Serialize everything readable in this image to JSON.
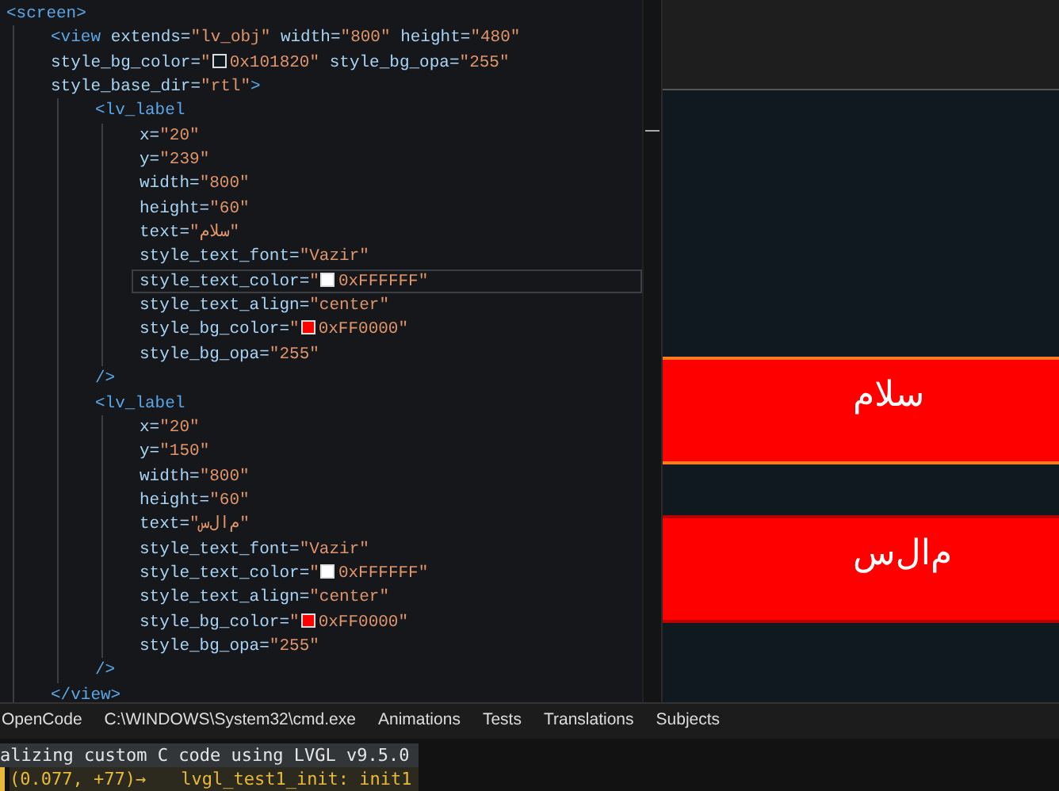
{
  "editor": {
    "lines": [
      {
        "current": false,
        "tokens": [
          {
            "kind": "tag",
            "text": "<screen>"
          }
        ],
        "children": [
          {
            "current": false,
            "tokens": [
              {
                "kind": "tag",
                "text": "<view"
              },
              {
                "kind": "attr",
                "text": " extends="
              },
              {
                "kind": "value",
                "text": "\"lv_obj\""
              },
              {
                "kind": "attr",
                "text": " width="
              },
              {
                "kind": "value",
                "text": "\"800\""
              },
              {
                "kind": "attr",
                "text": " height="
              },
              {
                "kind": "value",
                "text": "\"480\""
              }
            ]
          },
          {
            "current": false,
            "tokens": [
              {
                "kind": "attr",
                "text": "style_bg_color="
              },
              {
                "kind": "value",
                "text": "\""
              },
              {
                "kind": "swatch",
                "color": "#101820"
              },
              {
                "kind": "value",
                "text": "0x101820\""
              },
              {
                "kind": "attr",
                "text": " style_bg_opa="
              },
              {
                "kind": "value",
                "text": "\"255\""
              }
            ]
          },
          {
            "current": false,
            "tokens": [
              {
                "kind": "attr",
                "text": "style_base_dir="
              },
              {
                "kind": "value",
                "text": "\"rtl\""
              },
              {
                "kind": "tag",
                "text": ">"
              }
            ],
            "children": [
              {
                "current": false,
                "tokens": [
                  {
                    "kind": "tag",
                    "text": "<lv_label"
                  }
                ],
                "children": [
                  {
                    "current": false,
                    "tokens": [
                      {
                        "kind": "attr",
                        "text": "x="
                      },
                      {
                        "kind": "value",
                        "text": "\"20\""
                      }
                    ]
                  },
                  {
                    "current": false,
                    "tokens": [
                      {
                        "kind": "attr",
                        "text": "y="
                      },
                      {
                        "kind": "value",
                        "text": "\"239\""
                      }
                    ]
                  },
                  {
                    "current": false,
                    "tokens": [
                      {
                        "kind": "attr",
                        "text": "width="
                      },
                      {
                        "kind": "value",
                        "text": "\"800\""
                      }
                    ]
                  },
                  {
                    "current": false,
                    "tokens": [
                      {
                        "kind": "attr",
                        "text": "height="
                      },
                      {
                        "kind": "value",
                        "text": "\"60\""
                      }
                    ]
                  },
                  {
                    "current": false,
                    "tokens": [
                      {
                        "kind": "attr",
                        "text": "text="
                      },
                      {
                        "kind": "value",
                        "text": "\"سلام\""
                      }
                    ]
                  },
                  {
                    "current": false,
                    "tokens": [
                      {
                        "kind": "attr",
                        "text": "style_text_font="
                      },
                      {
                        "kind": "value",
                        "text": "\"Vazir\""
                      }
                    ]
                  },
                  {
                    "current": true,
                    "tokens": [
                      {
                        "kind": "attr",
                        "text": "style_text_color="
                      },
                      {
                        "kind": "value",
                        "text": "\""
                      },
                      {
                        "kind": "swatch",
                        "color": "#ffffff"
                      },
                      {
                        "kind": "value",
                        "text": "0xFFFFFF\""
                      }
                    ]
                  },
                  {
                    "current": false,
                    "tokens": [
                      {
                        "kind": "attr",
                        "text": "style_text_align="
                      },
                      {
                        "kind": "value",
                        "text": "\"center\""
                      }
                    ]
                  },
                  {
                    "current": false,
                    "tokens": [
                      {
                        "kind": "attr",
                        "text": "style_bg_color="
                      },
                      {
                        "kind": "value",
                        "text": "\""
                      },
                      {
                        "kind": "swatch",
                        "color": "#ff0000"
                      },
                      {
                        "kind": "value",
                        "text": "0xFF0000\""
                      }
                    ]
                  },
                  {
                    "current": false,
                    "tokens": [
                      {
                        "kind": "attr",
                        "text": "style_bg_opa="
                      },
                      {
                        "kind": "value",
                        "text": "\"255\""
                      }
                    ]
                  }
                ]
              },
              {
                "current": false,
                "tokens": [
                  {
                    "kind": "tag",
                    "text": "/>"
                  }
                ]
              },
              {
                "current": false,
                "tokens": [
                  {
                    "kind": "tag",
                    "text": "<lv_label"
                  }
                ],
                "children": [
                  {
                    "current": false,
                    "tokens": [
                      {
                        "kind": "attr",
                        "text": "x="
                      },
                      {
                        "kind": "value",
                        "text": "\"20\""
                      }
                    ]
                  },
                  {
                    "current": false,
                    "tokens": [
                      {
                        "kind": "attr",
                        "text": "y="
                      },
                      {
                        "kind": "value",
                        "text": "\"150\""
                      }
                    ]
                  },
                  {
                    "current": false,
                    "tokens": [
                      {
                        "kind": "attr",
                        "text": "width="
                      },
                      {
                        "kind": "value",
                        "text": "\"800\""
                      }
                    ]
                  },
                  {
                    "current": false,
                    "tokens": [
                      {
                        "kind": "attr",
                        "text": "height="
                      },
                      {
                        "kind": "value",
                        "text": "\"60\""
                      }
                    ]
                  },
                  {
                    "current": false,
                    "tokens": [
                      {
                        "kind": "attr",
                        "text": "text="
                      },
                      {
                        "kind": "value",
                        "text": "\"ﻡﺍﻝﺱ\""
                      }
                    ]
                  },
                  {
                    "current": false,
                    "tokens": [
                      {
                        "kind": "attr",
                        "text": "style_text_font="
                      },
                      {
                        "kind": "value",
                        "text": "\"Vazir\""
                      }
                    ]
                  },
                  {
                    "current": false,
                    "tokens": [
                      {
                        "kind": "attr",
                        "text": "style_text_color="
                      },
                      {
                        "kind": "value",
                        "text": "\""
                      },
                      {
                        "kind": "swatch",
                        "color": "#ffffff"
                      },
                      {
                        "kind": "value",
                        "text": "0xFFFFFF\""
                      }
                    ]
                  },
                  {
                    "current": false,
                    "tokens": [
                      {
                        "kind": "attr",
                        "text": "style_text_align="
                      },
                      {
                        "kind": "value",
                        "text": "\"center\""
                      }
                    ]
                  },
                  {
                    "current": false,
                    "tokens": [
                      {
                        "kind": "attr",
                        "text": "style_bg_color="
                      },
                      {
                        "kind": "value",
                        "text": "\""
                      },
                      {
                        "kind": "swatch",
                        "color": "#ff0000"
                      },
                      {
                        "kind": "value",
                        "text": "0xFF0000\""
                      }
                    ]
                  },
                  {
                    "current": false,
                    "tokens": [
                      {
                        "kind": "attr",
                        "text": "style_bg_opa="
                      },
                      {
                        "kind": "value",
                        "text": "\"255\""
                      }
                    ]
                  }
                ]
              },
              {
                "current": false,
                "tokens": [
                  {
                    "kind": "tag",
                    "text": "/>"
                  }
                ]
              }
            ]
          },
          {
            "current": false,
            "tokens": [
              {
                "kind": "tag",
                "text": "</view>"
              }
            ]
          }
        ]
      }
    ]
  },
  "preview": {
    "labels": [
      {
        "text": "سلام",
        "selected": true
      },
      {
        "text": "ﻡﺍﻝﺱ",
        "selected": false
      }
    ]
  },
  "tabs": [
    "OpenCode",
    "C:\\WINDOWS\\System32\\cmd.exe",
    "Animations",
    "Tests",
    "Translations",
    "Subjects"
  ],
  "terminal": {
    "lines": [
      {
        "kind": "plain",
        "texts": [
          "alizing custom C code using LVGL v9.5.0"
        ]
      },
      {
        "kind": "log",
        "texts": [
          "(0.077, +77)→",
          "lvgl_test1_init: init1"
        ]
      }
    ]
  }
}
